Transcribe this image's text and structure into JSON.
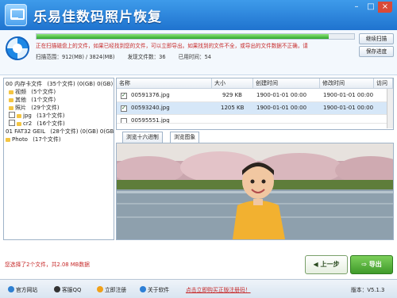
{
  "app": {
    "title": "乐易佳数码照片恢复"
  },
  "window_buttons": {
    "min": "–",
    "max": "□",
    "close": "×"
  },
  "progress": {
    "fraction": 0.92,
    "message": "正在扫描磁盘上的文件，如果已经找到您的文件，可以立即导出。如果找到的文件不全，或导出的文件数据不正确，请",
    "range_label": "扫描范围：912(MB) / 3824(MB)",
    "found_label": "发现文件数：36",
    "time_label": "已用时间：54"
  },
  "side_buttons": {
    "continue_scan": "继续扫描",
    "save_progress": "保存进度"
  },
  "tree": {
    "items": [
      {
        "label": "00 内存卡文件",
        "count": "(35个文件) (0(GB) 0(GB))"
      },
      {
        "label": "视频",
        "count": "(5个文件)"
      },
      {
        "label": "其他",
        "count": "(1个文件)"
      },
      {
        "label": "照片",
        "count": "(29个文件)"
      },
      {
        "label": "jpg",
        "count": "(13个文件)"
      },
      {
        "label": "cr2",
        "count": "(16个文件)"
      },
      {
        "label": "01 FAT32 GEIL",
        "count": "(28个文件) (0(GB) 0(GB))"
      },
      {
        "label": "Photo",
        "count": "(17个文件)"
      }
    ]
  },
  "table": {
    "headers": [
      "名称",
      "大小",
      "创建时间",
      "修改时间",
      "访问"
    ],
    "rows": [
      {
        "name": "00591376.jpg",
        "size": "929 KB",
        "created": "1900-01-01 00:00",
        "modified": "1900-01-01 00:00"
      },
      {
        "name": "00593240.jpg",
        "size": "1205 KB",
        "created": "1900-01-01 00:00",
        "modified": "1900-01-01 00:00"
      },
      {
        "name": "00595551.jpg",
        "size": "",
        "created": "",
        "modified": ""
      }
    ]
  },
  "preview_tabs": {
    "hex": "浏览十六进制",
    "image": "浏览图象"
  },
  "status": {
    "selection": "您选择了2个文件，共2.08 MB数据"
  },
  "nav": {
    "prev": "上一步",
    "export": "导出"
  },
  "bottom": {
    "website": "官方网站",
    "qq": "客服QQ",
    "register": "立即注册",
    "about": "关于软件",
    "promo": "点击立即购买正版注册码！",
    "version": "版本：V5.1.3"
  }
}
